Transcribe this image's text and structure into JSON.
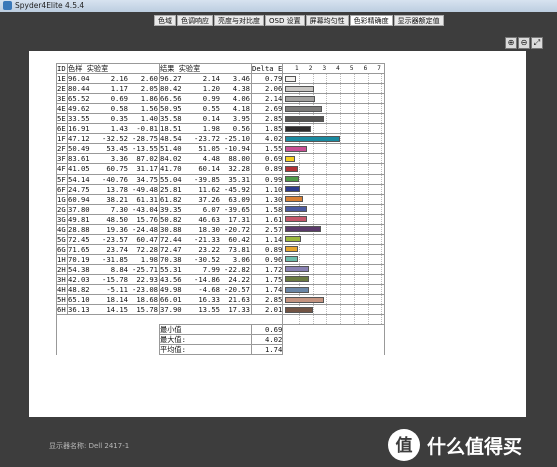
{
  "window": {
    "title": "Spyder4Elite 4.5.4"
  },
  "tabs": [
    {
      "label": "色域",
      "active": false
    },
    {
      "label": "色调响应",
      "active": false
    },
    {
      "label": "亮度与对比度",
      "active": false
    },
    {
      "label": "OSD 设置",
      "active": false
    },
    {
      "label": "屏幕均匀性",
      "active": false
    },
    {
      "label": "色彩精确度",
      "active": true
    },
    {
      "label": "显示器额定值",
      "active": false
    }
  ],
  "toolbar": {
    "zoom_in": "⊕",
    "zoom_out": "⊖",
    "expand": "⤢"
  },
  "table": {
    "headers": {
      "id": "ID",
      "ref": "色样 实验室",
      "meas": "结果 实验室",
      "de": "Delta E"
    },
    "scale_ticks": [
      "1",
      "2",
      "3",
      "4",
      "5",
      "6",
      "7"
    ],
    "rows": [
      {
        "id": "1E",
        "r": [
          "96.04",
          "2.16",
          "2.60"
        ],
        "m": [
          "96.27",
          "2.14",
          "3.46"
        ],
        "de": "0.79",
        "dev": 0.79,
        "color": "#f3f1ee"
      },
      {
        "id": "2E",
        "r": [
          "80.44",
          "1.17",
          "2.05"
        ],
        "m": [
          "80.42",
          "1.20",
          "4.38"
        ],
        "de": "2.06",
        "dev": 2.06,
        "color": "#c8c6c3"
      },
      {
        "id": "3E",
        "r": [
          "65.52",
          "0.69",
          "1.86"
        ],
        "m": [
          "66.56",
          "0.99",
          "4.06",
          "2.14"
        ],
        "de": "2.14",
        "dev": 2.14,
        "color": "#a3a2a0"
      },
      {
        "id": "4E",
        "r": [
          "49.62",
          "0.58",
          "1.56"
        ],
        "m": [
          "50.95",
          "0.55",
          "4.18"
        ],
        "de": "2.69",
        "dev": 2.69,
        "color": "#7b7a78"
      },
      {
        "id": "5E",
        "r": [
          "33.55",
          "0.35",
          "1.40"
        ],
        "m": [
          "35.58",
          "0.14",
          "3.95"
        ],
        "de": "2.85",
        "dev": 2.85,
        "color": "#555452"
      },
      {
        "id": "6E",
        "r": [
          "16.91",
          "1.43",
          "-0.81"
        ],
        "m": [
          "18.51",
          "1.98",
          "0.56"
        ],
        "de": "1.85",
        "dev": 1.85,
        "color": "#2d2b2b"
      },
      {
        "id": "1F",
        "r": [
          "47.12",
          "-32.52",
          "-28.75"
        ],
        "m": [
          "48.54",
          "-23.72",
          "-25.10"
        ],
        "de": "4.02",
        "dev": 4.02,
        "color": "#1a8aa0"
      },
      {
        "id": "2F",
        "r": [
          "50.49",
          "53.45",
          "-13.55"
        ],
        "m": [
          "51.40",
          "51.05",
          "-10.94"
        ],
        "de": "1.55",
        "dev": 1.55,
        "color": "#c84e93"
      },
      {
        "id": "3F",
        "r": [
          "83.61",
          "3.36",
          "87.02"
        ],
        "m": [
          "84.02",
          "4.48",
          "88.00"
        ],
        "de": "0.69",
        "dev": 0.69,
        "color": "#f6cd1f"
      },
      {
        "id": "4F",
        "r": [
          "41.05",
          "60.75",
          "31.17"
        ],
        "m": [
          "41.70",
          "60.14",
          "32.28"
        ],
        "de": "0.89",
        "dev": 0.89,
        "color": "#b23237"
      },
      {
        "id": "5F",
        "r": [
          "54.14",
          "-40.76",
          "34.75"
        ],
        "m": [
          "55.04",
          "-39.85",
          "35.31"
        ],
        "de": "0.99",
        "dev": 0.99,
        "color": "#4d9a47"
      },
      {
        "id": "6F",
        "r": [
          "24.75",
          "13.78",
          "-49.48"
        ],
        "m": [
          "25.81",
          "11.62",
          "-45.92"
        ],
        "de": "1.10",
        "dev": 1.1,
        "color": "#2c3b8e"
      },
      {
        "id": "1G",
        "r": [
          "60.94",
          "38.21",
          "61.31"
        ],
        "m": [
          "61.82",
          "37.26",
          "63.09"
        ],
        "de": "1.30",
        "dev": 1.3,
        "color": "#d88034"
      },
      {
        "id": "2G",
        "r": [
          "37.80",
          "7.30",
          "-43.04"
        ],
        "m": [
          "39.35",
          "6.07",
          "-39.65"
        ],
        "de": "1.58",
        "dev": 1.58,
        "color": "#4a5aa0"
      },
      {
        "id": "3G",
        "r": [
          "49.81",
          "48.50",
          "15.76"
        ],
        "m": [
          "50.82",
          "46.63",
          "17.31"
        ],
        "de": "1.61",
        "dev": 1.61,
        "color": "#c4566a"
      },
      {
        "id": "4G",
        "r": [
          "28.88",
          "19.36",
          "-24.48"
        ],
        "m": [
          "30.88",
          "18.30",
          "-20.72"
        ],
        "de": "2.57",
        "dev": 2.57,
        "color": "#5a3a6a"
      },
      {
        "id": "5G",
        "r": [
          "72.45",
          "-23.57",
          "60.47"
        ],
        "m": [
          "72.44",
          "-21.33",
          "60.42"
        ],
        "de": "1.14",
        "dev": 1.14,
        "color": "#9cb83c"
      },
      {
        "id": "6G",
        "r": [
          "71.65",
          "23.74",
          "72.28"
        ],
        "m": [
          "72.47",
          "23.22",
          "73.81"
        ],
        "de": "0.89",
        "dev": 0.89,
        "color": "#e4a52c"
      },
      {
        "id": "1H",
        "r": [
          "70.19",
          "-31.85",
          "1.98"
        ],
        "m": [
          "70.38",
          "-30.52",
          "3.06"
        ],
        "de": "0.96",
        "dev": 0.96,
        "color": "#6bbcaa"
      },
      {
        "id": "2H",
        "r": [
          "54.38",
          "8.84",
          "-25.71"
        ],
        "m": [
          "55.31",
          "7.99",
          "-22.82"
        ],
        "de": "1.72",
        "dev": 1.72,
        "color": "#8880b2"
      },
      {
        "id": "3H",
        "r": [
          "42.03",
          "-15.78",
          "22.93"
        ],
        "m": [
          "43.56",
          "-14.86",
          "24.22"
        ],
        "de": "1.75",
        "dev": 1.75,
        "color": "#6a7a40"
      },
      {
        "id": "4H",
        "r": [
          "48.82",
          "-5.11",
          "-23.08"
        ],
        "m": [
          "49.98",
          "-4.68",
          "-20.57"
        ],
        "de": "1.74",
        "dev": 1.74,
        "color": "#6a86a6"
      },
      {
        "id": "5H",
        "r": [
          "65.10",
          "18.14",
          "18.68"
        ],
        "m": [
          "66.01",
          "16.33",
          "21.63"
        ],
        "de": "2.85",
        "dev": 2.85,
        "color": "#c49480"
      },
      {
        "id": "6H",
        "r": [
          "36.13",
          "14.15",
          "15.78"
        ],
        "m": [
          "37.90",
          "13.55",
          "17.33"
        ],
        "de": "2.01",
        "dev": 2.01,
        "color": "#725444"
      }
    ],
    "summary": [
      {
        "label": "最小值",
        "value": "0.69"
      },
      {
        "label": "最大值:",
        "value": "4.02"
      },
      {
        "label": "平均值:",
        "value": "1.74"
      }
    ]
  },
  "footer": {
    "display_name": "显示器名称: Dell 2417-1"
  },
  "brand": {
    "logo_text": "值 什么值得买"
  }
}
